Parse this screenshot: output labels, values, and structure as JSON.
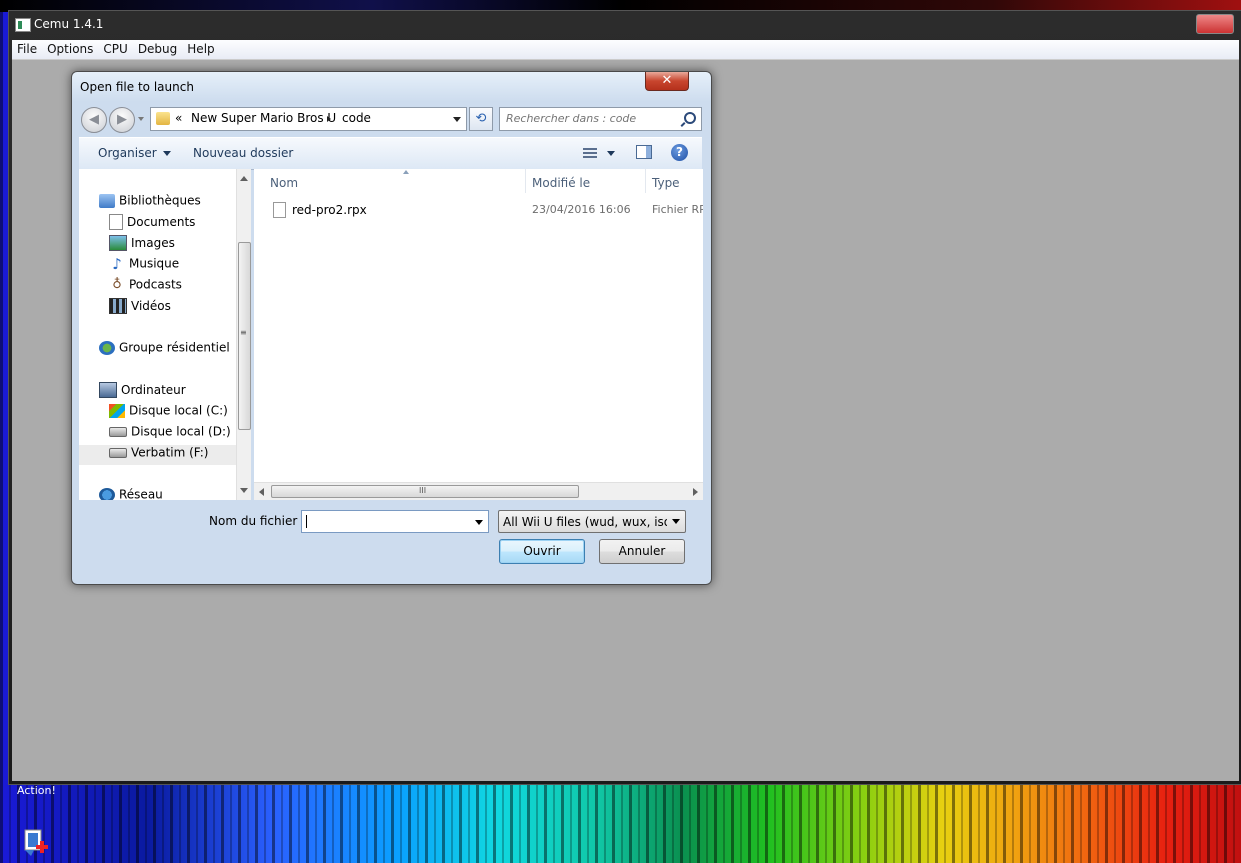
{
  "desktop": {
    "action_label": "Action!"
  },
  "cemu": {
    "title": "Cemu 1.4.1",
    "menu": [
      "File",
      "Options",
      "CPU",
      "Debug",
      "Help"
    ]
  },
  "dialog": {
    "title": "Open file to launch",
    "close_glyph": "✕",
    "address": {
      "chevron": "«",
      "crumbs": [
        "New Super Mario Bros U",
        "code"
      ]
    },
    "search_placeholder": "Rechercher dans : code",
    "toolbar": {
      "organize": "Organiser",
      "new_folder": "Nouveau dossier",
      "help_glyph": "?"
    },
    "nav": [
      {
        "label": "Bibliothèques",
        "icon": "library-icon"
      },
      {
        "label": "Documents",
        "icon": "documents-icon"
      },
      {
        "label": "Images",
        "icon": "images-icon"
      },
      {
        "label": "Musique",
        "icon": "music-icon"
      },
      {
        "label": "Podcasts",
        "icon": "podcasts-icon"
      },
      {
        "label": "Vidéos",
        "icon": "videos-icon"
      },
      {
        "label": "Groupe résidentiel",
        "icon": "homegroup-icon"
      },
      {
        "label": "Ordinateur",
        "icon": "computer-icon"
      },
      {
        "label": "Disque local (C:)",
        "icon": "windows-drive-icon"
      },
      {
        "label": "Disque local (D:)",
        "icon": "drive-icon"
      },
      {
        "label": "Verbatim (F:)",
        "icon": "usb-drive-icon",
        "selected": true
      },
      {
        "label": "Réseau",
        "icon": "network-icon"
      }
    ],
    "columns": [
      "Nom",
      "Modifié le",
      "Type"
    ],
    "files": [
      {
        "name": "red-pro2.rpx",
        "modified": "23/04/2016 16:06",
        "type": "Fichier RP"
      }
    ],
    "filename_label": "Nom du fichier :",
    "filename_value": "",
    "filetype": "All Wii U files (wud, wux, iso, wad, rpx)",
    "open_label": "Ouvrir",
    "cancel_label": "Annuler",
    "scroll_grip": "≡",
    "hscroll_grip": "III"
  }
}
